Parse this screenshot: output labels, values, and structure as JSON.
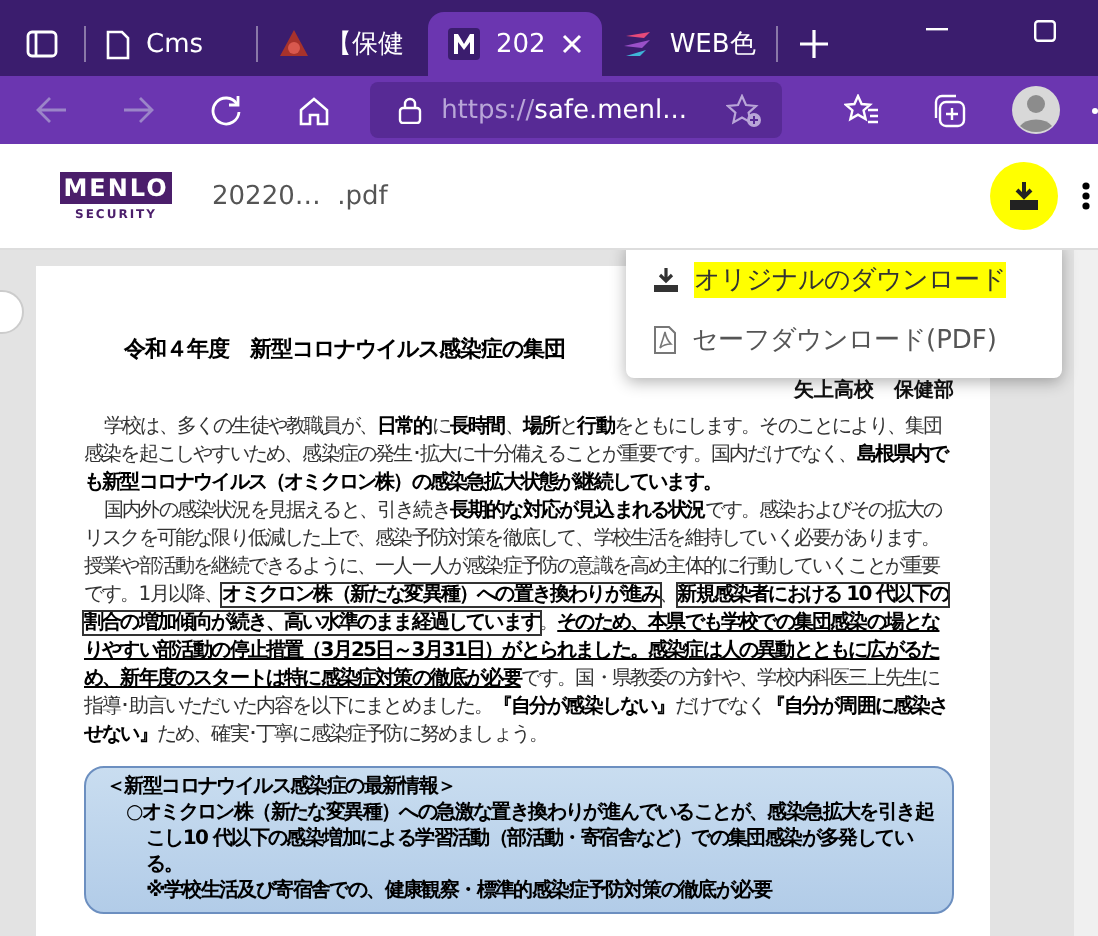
{
  "tabs": [
    {
      "kind": "page",
      "label": "Cms",
      "selected": false
    },
    {
      "kind": "logo-red",
      "label": "【保健",
      "selected": false
    },
    {
      "kind": "logo-m",
      "label": "202",
      "selected": true
    },
    {
      "kind": "logo-color",
      "label": "WEB色",
      "selected": false
    }
  ],
  "toolbar": {
    "back_disabled": true,
    "forward_disabled": true,
    "url_prefix": "https://",
    "url_host": "safe.menl..."
  },
  "viewer": {
    "logo_top": "MENLO",
    "logo_bottom": "SECURITY",
    "filename": "20220…  .pdf",
    "download_highlighted": true
  },
  "download_menu": [
    {
      "kind": "download",
      "label": "オリジナルのダウンロード",
      "highlighted": true
    },
    {
      "kind": "pdf",
      "label": "セーフダウンロード(PDF)",
      "highlighted": false
    }
  ],
  "document": {
    "title": "令和４年度　新型コロナウイルス感染症の集団",
    "author": "矢上高校　保健部",
    "paragraph_1": "学校は、多くの生徒や教職員が、**日常的**に**長時間**、**場所**と**行動**をともにします。そのことにより、集団感染を起こしやすいため、感染症の発生･拡大に十分備えることが重要です。国内だけでなく、**島根県内でも新型コロナウイルス（オミクロン株）の感染急拡大状態が継続しています。**",
    "paragraph_2": [
      {
        "kind": "plain",
        "text": "国内外の感染状況を見据えると、引き続き"
      },
      {
        "kind": "bold",
        "text": "長期的な対応が見込まれる状況"
      },
      {
        "kind": "plain",
        "text": "です。感染およびその拡大のリスクを可能な限り低減した上で、感染予防対策を徹底して、学校生活を維持していく必要があります。授業や部活動を継続できるように、一人一人が感染症予防の意識を高め主体的に行動していくことが重要です。1月以降、"
      },
      {
        "kind": "boxed",
        "text": "オミクロン株（新たな変異種）への置き換わりが進み"
      },
      {
        "kind": "plain",
        "text": "、"
      },
      {
        "kind": "boxed",
        "text": "新規感染者における 10 代以下の割合の増加傾向が続き、高い水準のまま経過しています"
      },
      {
        "kind": "plain",
        "text": "。"
      },
      {
        "kind": "underlined",
        "text": "そのため、本県でも学校での集団感染の場となりやすい部活動の停止措置（3月25日～3月31日）がとられました。感染症は人の異動とともに広がるため、新年度のスタートは特に感染症対策の徹底が必要"
      },
      {
        "kind": "plain",
        "text": "です。国・県教委の方針や、学校内科医三上先生に指導･助言いただいた内容を以下にまとめました。"
      },
      {
        "kind": "bold",
        "text": "『自分が感染しない』"
      },
      {
        "kind": "plain",
        "text": "だけでなく"
      },
      {
        "kind": "bold",
        "text": "『自分が周囲に感染させない』"
      },
      {
        "kind": "plain",
        "text": "ため、確実･丁寧に感染症予防に努めましょう。"
      }
    ],
    "info_box": {
      "title": "＜新型コロナウイルス感染症の最新情報＞",
      "item": "○オミクロン株（新たな変異種）への急激な置き換わりが進んでいることが、感染急拡大を引き起こし10 代以下の感染増加による学習活動（部活動・寄宿舎など）での集団感染が多発している。",
      "note": "※学校生活及び寄宿舎での、健康観察・標準的感染症予防対策の徹底が必要"
    }
  }
}
